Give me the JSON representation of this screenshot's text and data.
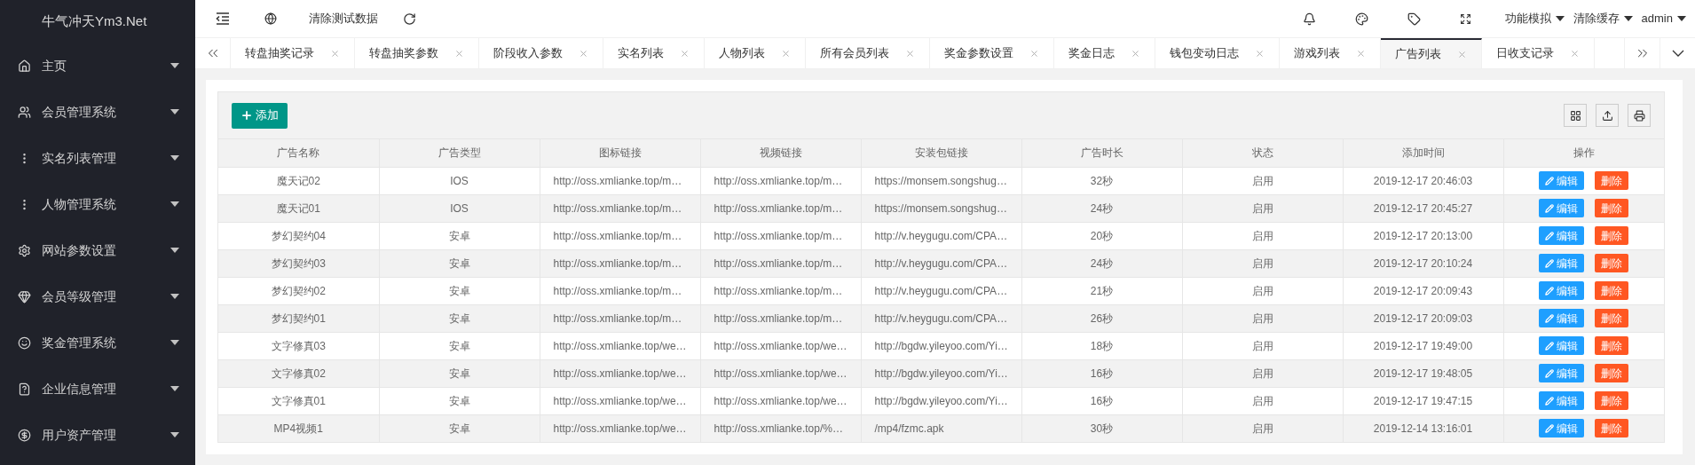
{
  "sidebar": {
    "logo": "牛气冲天Ym3.Net",
    "items": [
      {
        "label": "主页"
      },
      {
        "label": "会员管理系统"
      },
      {
        "label": "实名列表管理"
      },
      {
        "label": "人物管理系统"
      },
      {
        "label": "网站参数设置"
      },
      {
        "label": "会员等级管理"
      },
      {
        "label": "奖金管理系统"
      },
      {
        "label": "企业信息管理"
      },
      {
        "label": "用户资产管理"
      }
    ]
  },
  "header": {
    "clear_test_data": "清除测试数据",
    "menus": [
      "功能模拟",
      "清除缓存",
      "admin"
    ]
  },
  "tabs": [
    {
      "label": "转盘抽奖记录",
      "selected": false
    },
    {
      "label": "转盘抽奖参数",
      "selected": false
    },
    {
      "label": "阶段收入参数",
      "selected": false
    },
    {
      "label": "实名列表",
      "selected": false
    },
    {
      "label": "人物列表",
      "selected": false
    },
    {
      "label": "所有会员列表",
      "selected": false
    },
    {
      "label": "奖金参数设置",
      "selected": false
    },
    {
      "label": "奖金日志",
      "selected": false
    },
    {
      "label": "钱包变动日志",
      "selected": false
    },
    {
      "label": "游戏列表",
      "selected": false
    },
    {
      "label": "广告列表",
      "selected": true
    },
    {
      "label": "日收支记录",
      "selected": false
    }
  ],
  "toolbar": {
    "add_button": "添加"
  },
  "table": {
    "columns": [
      "广告名称",
      "广告类型",
      "图标链接",
      "视频链接",
      "安装包链接",
      "广告时长",
      "状态",
      "添加时间",
      "操作"
    ],
    "rows": [
      {
        "cells": [
          "魔天记02",
          "IOS",
          "http://oss.xmlianke.top/m…",
          "http://oss.xmlianke.top/m…",
          "https://monsem.songshug…",
          "32秒",
          "启用",
          "2019-12-17 20:46:03"
        ],
        "actions": [
          "编辑",
          "删除"
        ]
      },
      {
        "cells": [
          "魔天记01",
          "IOS",
          "http://oss.xmlianke.top/m…",
          "http://oss.xmlianke.top/m…",
          "https://monsem.songshug…",
          "24秒",
          "启用",
          "2019-12-17 20:45:27"
        ],
        "actions": [
          "编辑",
          "删除"
        ]
      },
      {
        "cells": [
          "梦幻契约04",
          "安卓",
          "http://oss.xmlianke.top/m…",
          "http://oss.xmlianke.top/m…",
          "http://v.heygugu.com/CPA…",
          "20秒",
          "启用",
          "2019-12-17 20:13:00"
        ],
        "actions": [
          "编辑",
          "删除"
        ]
      },
      {
        "cells": [
          "梦幻契约03",
          "安卓",
          "http://oss.xmlianke.top/m…",
          "http://oss.xmlianke.top/m…",
          "http://v.heygugu.com/CPA…",
          "24秒",
          "启用",
          "2019-12-17 20:10:24"
        ],
        "actions": [
          "编辑",
          "删除"
        ]
      },
      {
        "cells": [
          "梦幻契约02",
          "安卓",
          "http://oss.xmlianke.top/m…",
          "http://oss.xmlianke.top/m…",
          "http://v.heygugu.com/CPA…",
          "21秒",
          "启用",
          "2019-12-17 20:09:43"
        ],
        "actions": [
          "编辑",
          "删除"
        ]
      },
      {
        "cells": [
          "梦幻契约01",
          "安卓",
          "http://oss.xmlianke.top/m…",
          "http://oss.xmlianke.top/m…",
          "http://v.heygugu.com/CPA…",
          "26秒",
          "启用",
          "2019-12-17 20:09:03"
        ],
        "actions": [
          "编辑",
          "删除"
        ]
      },
      {
        "cells": [
          "文字修真03",
          "安卓",
          "http://oss.xmlianke.top/we…",
          "http://oss.xmlianke.top/we…",
          "http://bgdw.yileyoo.com/Yi…",
          "18秒",
          "启用",
          "2019-12-17 19:49:00"
        ],
        "actions": [
          "编辑",
          "删除"
        ]
      },
      {
        "cells": [
          "文字修真02",
          "安卓",
          "http://oss.xmlianke.top/we…",
          "http://oss.xmlianke.top/we…",
          "http://bgdw.yileyoo.com/Yi…",
          "16秒",
          "启用",
          "2019-12-17 19:48:05"
        ],
        "actions": [
          "编辑",
          "删除"
        ]
      },
      {
        "cells": [
          "文字修真01",
          "安卓",
          "http://oss.xmlianke.top/we…",
          "http://oss.xmlianke.top/we…",
          "http://bgdw.yileyoo.com/Yi…",
          "16秒",
          "启用",
          "2019-12-17 19:47:15"
        ],
        "actions": [
          "编辑",
          "删除"
        ]
      },
      {
        "cells": [
          "MP4视频1",
          "安卓",
          "http://oss.xmlianke.top/we…",
          "http://oss.xmlianke.top/%…",
          "/mp4/fzmc.apk",
          "30秒",
          "启用",
          "2019-12-14 13:16:01"
        ],
        "actions": [
          "编辑",
          "删除"
        ]
      }
    ]
  }
}
